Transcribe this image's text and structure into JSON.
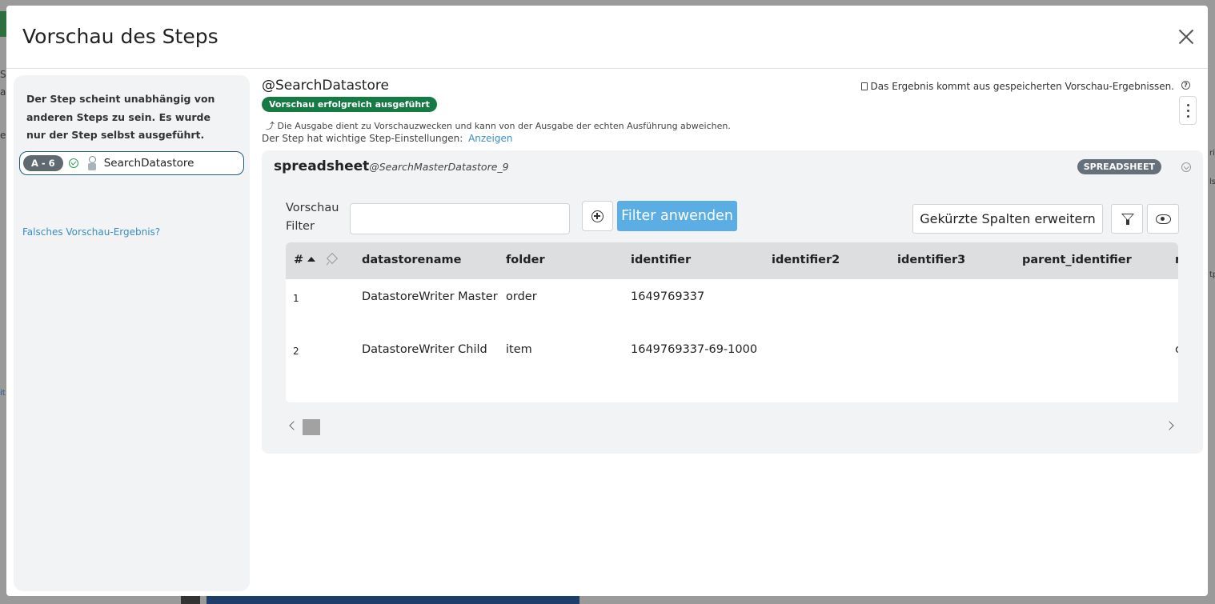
{
  "modal": {
    "title": "Vorschau des Steps"
  },
  "left_panel": {
    "description": "Der Step scheint unabhängig von anderen Steps zu sein. Es wurde nur der Step selbst ausgeführt.",
    "step": {
      "badge": "A - 6",
      "name": "SearchDatastore"
    },
    "wrong_result_link": "Falsches Vorschau-Ergebnis?"
  },
  "step_header": {
    "title": "@SearchDatastore",
    "status_badge": "Vorschau erfolgreich ausgeführt",
    "info": "Die Ausgabe dient zu Vorschauzwecken und kann von der Ausgabe der echten Ausführung abweichen.",
    "settings_text": "Der Step hat wichtige Step-Einstellungen:",
    "settings_link": "Anzeigen",
    "cache_note": "Das Ergebnis kommt aus gespeicherten Vorschau-Ergebnissen.",
    "help_glyph": "?"
  },
  "spreadsheet": {
    "name": "spreadsheet",
    "source": "@SearchMasterDatastore_9",
    "type_badge": "SPREADSHEET",
    "filter_label_1": "Vorschau",
    "filter_label_2": "Filter",
    "filter_input_value": "",
    "apply_filter_label": "Filter anwenden",
    "expand_columns_label": "Gekürzte Spalten erweitern",
    "columns": [
      "#",
      "datastorename",
      "folder",
      "identifier",
      "identifier2",
      "identifier3",
      "parent_identifier",
      "r"
    ],
    "rows": [
      {
        "num": "1",
        "datastorename": "DatastoreWriter Master",
        "folder": "order",
        "identifier": "1649769337",
        "identifier2": "",
        "identifier3": "",
        "parent_identifier": "",
        "extra": ""
      },
      {
        "num": "2",
        "datastorename": "DatastoreWriter Child",
        "folder": "item",
        "identifier": "1649769337-69-1000",
        "identifier2": "",
        "identifier3": "",
        "parent_identifier": "",
        "extra": "c"
      }
    ]
  },
  "icons": {
    "close": "close-icon",
    "check": "check-circle-icon",
    "database": "database-icon",
    "clipboard": "clipboard-icon",
    "help": "help-icon",
    "kebab": "kebab-menu-icon",
    "chevron": "chevron-down-icon",
    "add": "plus-circle-icon",
    "filter": "filter-icon",
    "eye": "eye-icon",
    "sort": "sort-asc-icon",
    "pin": "pin-icon",
    "arrow": "arrow-icon"
  },
  "background": {
    "side_text": [
      "S",
      "a",
      "e",
      "ri",
      "ls",
      "tp",
      "it"
    ]
  },
  "colors": {
    "accent": "#5aaee4",
    "success": "#157a44",
    "link": "#3a8ec2",
    "badge": "#5f6a70"
  }
}
